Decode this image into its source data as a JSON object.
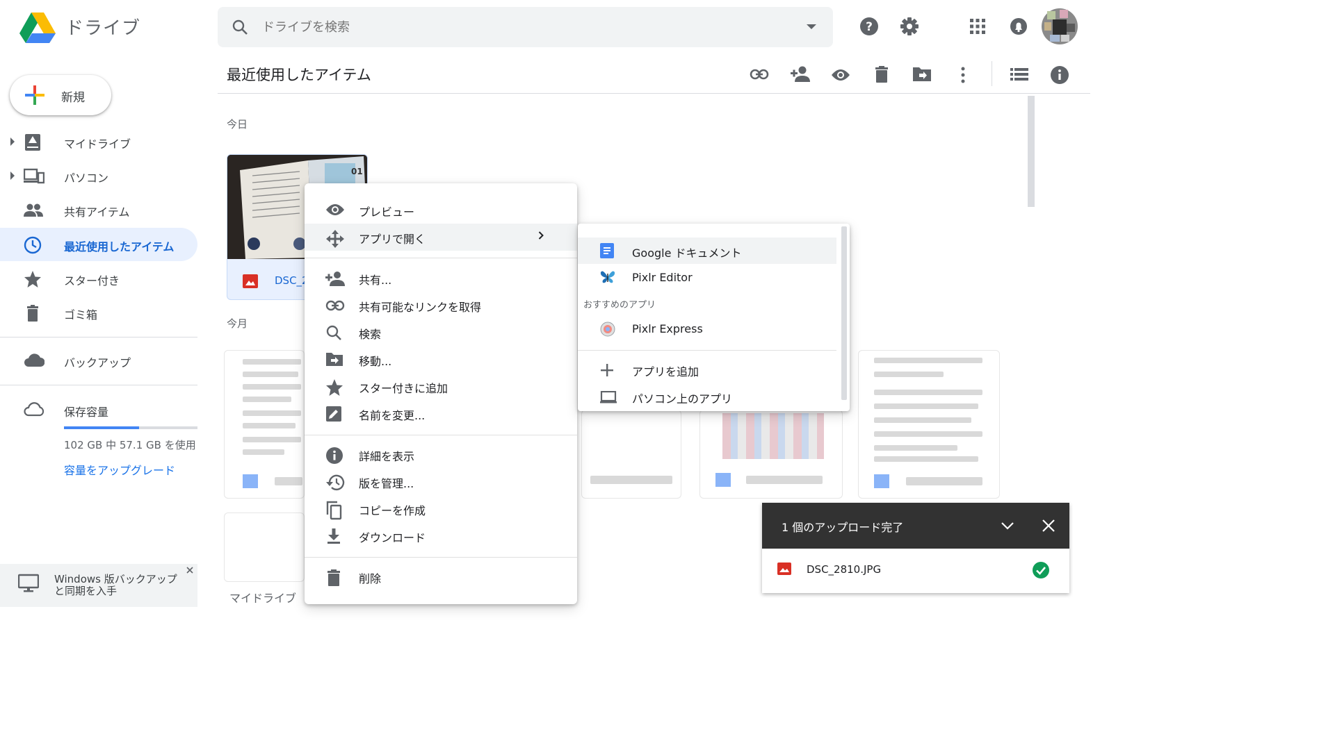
{
  "app": {
    "title": "ドライブ"
  },
  "search": {
    "placeholder": "ドライブを検索"
  },
  "sidebar": {
    "new_label": "新規",
    "items": [
      {
        "label": "マイドライブ"
      },
      {
        "label": "パソコン"
      },
      {
        "label": "共有アイテム"
      },
      {
        "label": "最近使用したアイテム"
      },
      {
        "label": "スター付き"
      },
      {
        "label": "ゴミ箱"
      },
      {
        "label": "バックアップ"
      }
    ],
    "storage": {
      "label": "保存容量",
      "usage_text": "102 GB 中 57.1 GB を使用",
      "used_fraction": 0.56,
      "upgrade_label": "容量をアップグレード"
    },
    "promo": {
      "text": "Windows 版バックアップ\nと同期を入手"
    }
  },
  "main": {
    "title": "最近使用したアイテム",
    "sections": {
      "today": "今日",
      "month": "今月"
    },
    "file": {
      "name": "DSC_2"
    },
    "breadcrumb": "マイドライブ"
  },
  "context_menu": {
    "items": [
      {
        "label": "プレビュー",
        "icon": "eye-icon"
      },
      {
        "label": "アプリで開く",
        "icon": "move-arrows-icon"
      },
      {
        "label": "共有...",
        "icon": "add-person-icon"
      },
      {
        "label": "共有可能なリンクを取得",
        "icon": "link-icon"
      },
      {
        "label": "検索",
        "icon": "search-icon"
      },
      {
        "label": "移動...",
        "icon": "move-folder-icon"
      },
      {
        "label": "スター付きに追加",
        "icon": "star-icon"
      },
      {
        "label": "名前を変更...",
        "icon": "rename-icon"
      },
      {
        "label": "詳細を表示",
        "icon": "info-icon"
      },
      {
        "label": "版を管理...",
        "icon": "history-icon"
      },
      {
        "label": "コピーを作成",
        "icon": "copy-icon"
      },
      {
        "label": "ダウンロード",
        "icon": "download-icon"
      },
      {
        "label": "削除",
        "icon": "trash-icon"
      }
    ]
  },
  "open_with_menu": {
    "apps": [
      {
        "label": "Google ドキュメント"
      },
      {
        "label": "Pixlr Editor"
      }
    ],
    "suggested_heading": "おすすめのアプリ",
    "suggested": [
      {
        "label": "Pixlr Express"
      }
    ],
    "add_app": "アプリを追加",
    "desktop_apps": "パソコン上のアプリ"
  },
  "upload_toast": {
    "title": "1 個のアップロード完了",
    "file_name": "DSC_2810.JPG"
  },
  "colors": {
    "accent": "#1a73e8",
    "active_bg": "#e8f0fe",
    "toast_bg": "#323232",
    "success": "#0f9d58"
  }
}
